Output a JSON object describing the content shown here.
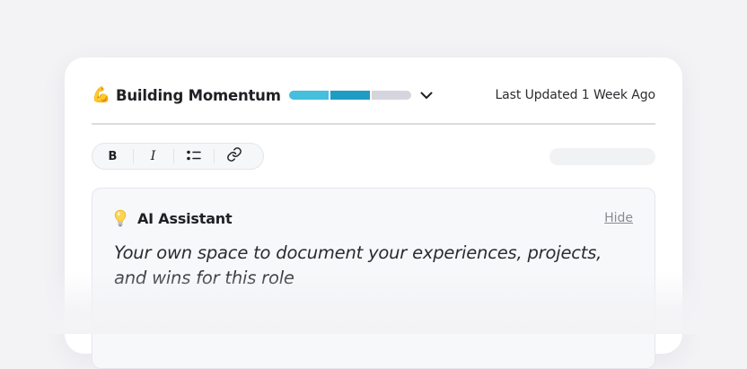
{
  "header": {
    "emoji": "💪",
    "title": "Building Momentum",
    "progress": {
      "segments_total": 3,
      "segments_filled": 2,
      "fill_colors": [
        "#45bfdb",
        "#1f9cc4"
      ],
      "empty_color": "#d5d6dd"
    },
    "dropdown_icon": "chevron-down-icon",
    "last_updated": "Last Updated 1 Week Ago"
  },
  "toolbar": {
    "bold_label": "B",
    "italic_label": "I",
    "list_icon": "bullet-list-icon",
    "link_icon": "link-icon"
  },
  "assistant": {
    "icon": "lightbulb-icon",
    "title": "AI Assistant",
    "hide_label": "Hide",
    "body": "Your own space to document your experiences, projects, and wins for this role"
  }
}
